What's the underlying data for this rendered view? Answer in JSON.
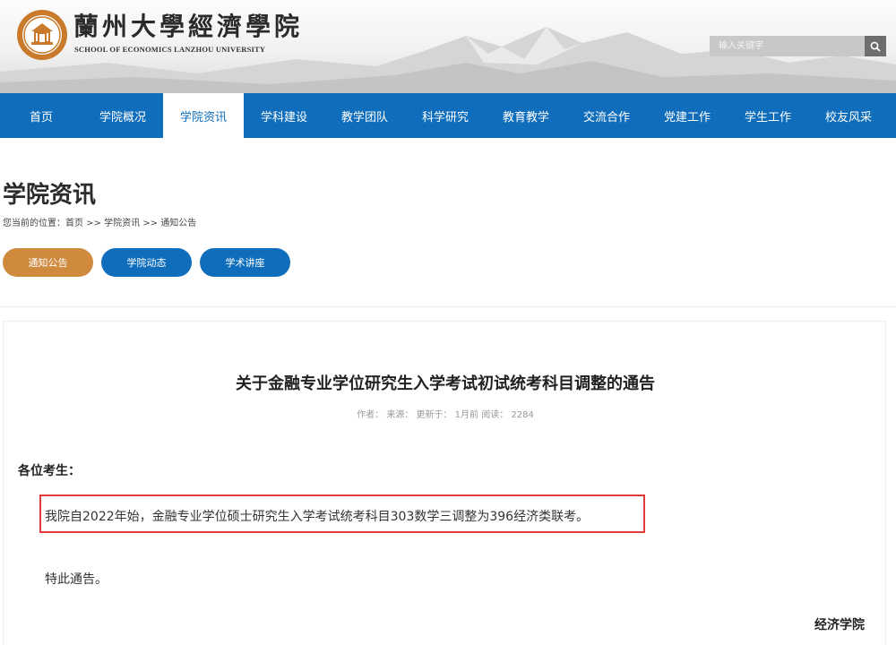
{
  "header": {
    "title": "蘭州大學經濟學院",
    "subtitle": "SCHOOL OF ECONOMICS LANZHOU UNIVERSITY",
    "search": {
      "placeholder": "输入关键字",
      "icon": "search-icon"
    }
  },
  "nav": {
    "items": [
      {
        "label": "首页"
      },
      {
        "label": "学院概况"
      },
      {
        "label": "学院资讯",
        "active": true
      },
      {
        "label": "学科建设"
      },
      {
        "label": "教学团队"
      },
      {
        "label": "科学研究"
      },
      {
        "label": "教育教学"
      },
      {
        "label": "交流合作"
      },
      {
        "label": "党建工作"
      },
      {
        "label": "学生工作"
      },
      {
        "label": "校友风采"
      }
    ]
  },
  "section": {
    "title": "学院资讯",
    "breadcrumb": "您当前的位置：首页 >> 学院资讯 >> 通知公告",
    "tabs": [
      {
        "label": "通知公告",
        "active": true
      },
      {
        "label": "学院动态"
      },
      {
        "label": "学术讲座"
      }
    ]
  },
  "article": {
    "title": "关于金融专业学位研究生入学考试初试统考科目调整的通告",
    "meta": "作者：  来源：  更新于：  1月前    阅读：  2284",
    "greeting": "各位考生：",
    "body": "我院自2022年始，金融专业学位硕士研究生入学考试统考科目303数学三调整为396经济类联考。",
    "closing": "特此通告。",
    "signature": "经济学院"
  },
  "colors": {
    "nav_blue": "#0f6dbb",
    "active_tab_orange": "#cf8a3e",
    "highlight_red": "#e23a3a"
  }
}
